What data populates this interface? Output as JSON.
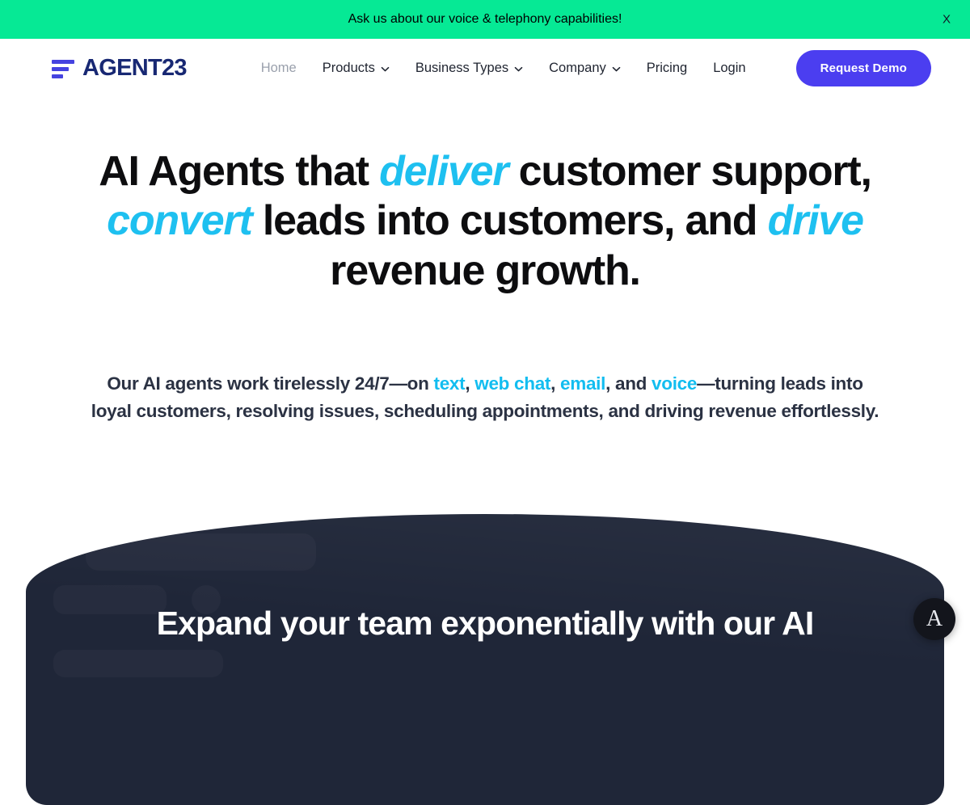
{
  "announcement": {
    "message": "Ask us about our voice & telephony capabilities!",
    "close_label": "X",
    "background_color": "#06E995"
  },
  "header": {
    "brand": {
      "wordmark": "AGENT23",
      "mark_icon": "three-bars-icon",
      "mark_color": "#4543E0",
      "wordmark_color": "#182873"
    },
    "nav_items": [
      {
        "label": "Home",
        "has_dropdown": false,
        "active": true
      },
      {
        "label": "Products",
        "has_dropdown": true,
        "active": false
      },
      {
        "label": "Business Types",
        "has_dropdown": true,
        "active": false
      },
      {
        "label": "Company",
        "has_dropdown": true,
        "active": false
      },
      {
        "label": "Pricing",
        "has_dropdown": false,
        "active": false
      },
      {
        "label": "Login",
        "has_dropdown": false,
        "active": false
      }
    ],
    "cta": {
      "label": "Request Demo",
      "background_color": "#4B3EF0",
      "text_color": "#FFFFFF"
    }
  },
  "hero": {
    "headline": {
      "part1": "AI Agents that ",
      "accent1": "deliver",
      "part2": " customer support, ",
      "accent2": "convert",
      "part3": " leads into customers, and ",
      "accent3": "drive",
      "part4": " revenue growth."
    },
    "subheadline": {
      "part1": "Our AI agents work tirelessly 24/7—on ",
      "channel1": "text",
      "sep1": ", ",
      "channel2": "web chat",
      "sep2": ", ",
      "channel3": "email",
      "sep3": ", and ",
      "channel4": "voice",
      "part2": "—turning leads into loyal customers, resolving issues, scheduling appointments, and driving revenue effortlessly."
    },
    "accent_color": "#1EC0F0"
  },
  "showcase": {
    "heading": "Expand your team exponentially with our AI",
    "background_color": "#1F2638",
    "text_color": "#FFFFFF"
  },
  "accessibility_widget": {
    "label": "A",
    "icon": "accessibility-icon"
  }
}
